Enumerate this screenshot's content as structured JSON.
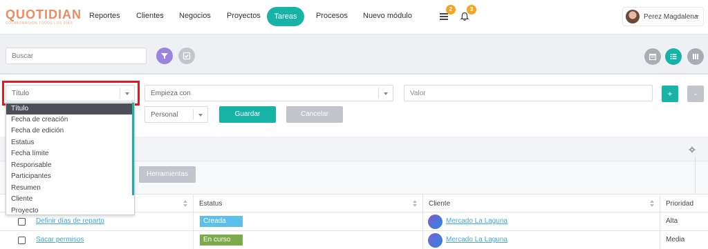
{
  "brand": {
    "name": "QUOTIDIAN",
    "tagline": "COLABORACIÓN TODOS LOS DÍAS",
    "color": "#f08a5d"
  },
  "nav": {
    "items": [
      "Reportes",
      "Clientes",
      "Negocios",
      "Proyectos",
      "Tareas",
      "Procesos",
      "Nuevo módulo"
    ],
    "active": "Tareas",
    "accent": "#16b3a6"
  },
  "header": {
    "messages_badge": "2",
    "notifications_badge": "3",
    "user_name": "Perez Magdalena"
  },
  "search": {
    "placeholder": "Buscar"
  },
  "filter": {
    "field_value": "Título",
    "operator_value": "Empieza con",
    "value_placeholder": "Valor",
    "scope_value": "Personal",
    "save_label": "Guardar",
    "cancel_label": "Cancelar",
    "add_label": "+",
    "remove_label": "-"
  },
  "dropdown": {
    "options": [
      "Título",
      "Fecha de creación",
      "Fecha de edición",
      "Estatus",
      "Fecha límite",
      "Responsable",
      "Participantes",
      "Resumen",
      "Cliente",
      "Proyecto"
    ],
    "selected": "Título"
  },
  "tools": {
    "label": "Herramientas"
  },
  "table": {
    "columns": [
      "",
      "Estatus",
      "Cliente",
      "Prioridad"
    ],
    "rows": [
      {
        "title": "Definir días de reparto",
        "status": "Creada",
        "status_color": "#5bc0eb",
        "client": "Mercado La Laguna",
        "priority": "Alta"
      },
      {
        "title": "Sacar permisos",
        "status": "En curso",
        "status_color": "#7bab4b",
        "client": "Mercado La Laguna",
        "priority": "Media"
      }
    ]
  }
}
